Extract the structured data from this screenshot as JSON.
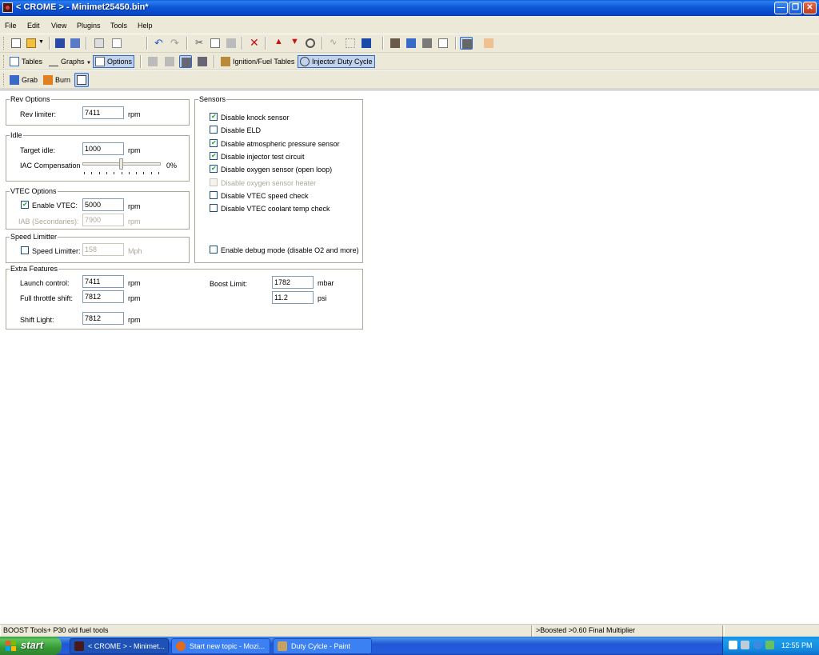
{
  "window": {
    "title": "< CROME > - Minimet25450.bin*"
  },
  "menu": [
    "File",
    "Edit",
    "View",
    "Plugins",
    "Tools",
    "Help"
  ],
  "toolbar2": {
    "tables": "Tables",
    "graphs": "Graphs",
    "options": "Options",
    "ignition_fuel": "Ignition/Fuel Tables",
    "injector_duty": "Injector Duty Cycle"
  },
  "toolbar3": {
    "grab": "Grab",
    "burn": "Burn"
  },
  "rev_options": {
    "legend": "Rev Options",
    "rev_limiter_label": "Rev limiter:",
    "rev_limiter_value": "7411",
    "unit": "rpm"
  },
  "idle": {
    "legend": "Idle",
    "target_label": "Target idle:",
    "target_value": "1000",
    "unit": "rpm",
    "iac_label": "IAC Compensation",
    "iac_value": "0%",
    "iac_slider_fraction": 0.5
  },
  "vtec": {
    "legend": "VTEC Options",
    "enable_label": "Enable VTEC:",
    "enable_checked": true,
    "enable_value": "5000",
    "unit": "rpm",
    "iab_label": "IAB (Secondaries):",
    "iab_value": "7900",
    "iab_unit": "rpm"
  },
  "speed_limiter": {
    "legend": "Speed Limitter",
    "label": "Speed Limitter:",
    "checked": false,
    "value": "158",
    "unit": "Mph"
  },
  "sensors": {
    "legend": "Sensors",
    "items": [
      {
        "label": "Disable knock sensor",
        "checked": true,
        "disabled": false
      },
      {
        "label": "Disable ELD",
        "checked": false,
        "disabled": false
      },
      {
        "label": "Disable atmospheric pressure sensor",
        "checked": true,
        "disabled": false
      },
      {
        "label": "Disable injector test circuit",
        "checked": true,
        "disabled": false
      },
      {
        "label": "Disable oxygen sensor (open loop)",
        "checked": true,
        "disabled": false
      },
      {
        "label": "Disable oxygen sensor heater",
        "checked": false,
        "disabled": true
      },
      {
        "label": "Disable VTEC speed check",
        "checked": false,
        "disabled": false
      },
      {
        "label": "Disable VTEC coolant temp check",
        "checked": false,
        "disabled": false
      }
    ],
    "debug_label": "Enable debug mode (disable O2 and more)",
    "debug_checked": false
  },
  "extra": {
    "legend": "Extra Features",
    "launch_label": "Launch control:",
    "launch_value": "7411",
    "full_throttle_label": "Full throttle shift:",
    "full_throttle_value": "7812",
    "shift_light_label": "Shift Light:",
    "shift_light_value": "7812",
    "unit": "rpm",
    "boost_label": "Boost Limit:",
    "boost_mbar": "1782",
    "boost_mbar_unit": "mbar",
    "boost_psi": "11.2",
    "boost_psi_unit": "psi"
  },
  "status": {
    "left": "BOOST Tools+ P30 old fuel tools",
    "right": ">Boosted >0.60 Final Multiplier"
  },
  "taskbar": {
    "start": "start",
    "tasks": [
      "< CROME > - Minimet...",
      "Start new topic - Mozi...",
      "Duty Cylcle - Paint"
    ],
    "clock": "12:55 PM"
  },
  "colors": {
    "titlebar": "#0a5fdc",
    "taskbar": "#245edb",
    "start": "#3c9a3c",
    "chrome": "#ece9d8"
  }
}
